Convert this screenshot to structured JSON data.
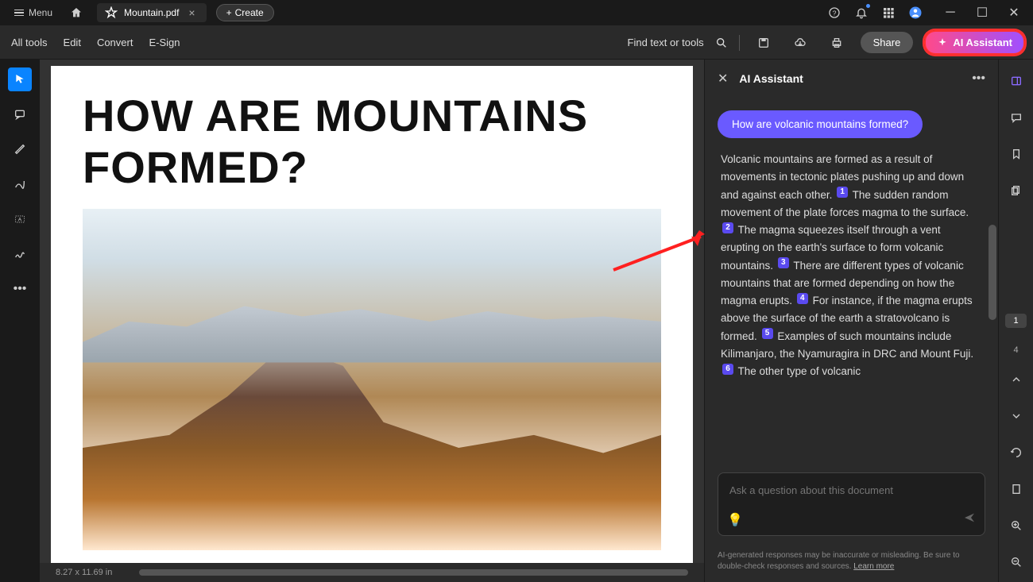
{
  "titlebar": {
    "menu_label": "Menu",
    "tab_name": "Mountain.pdf",
    "create_label": "Create"
  },
  "toolbar": {
    "all_tools": "All tools",
    "edit": "Edit",
    "convert": "Convert",
    "esign": "E-Sign",
    "find": "Find text or tools",
    "share": "Share",
    "ai_assistant": "AI Assistant"
  },
  "document": {
    "heading": "HOW ARE MOUNTAINS FORMED?",
    "page_size": "8.27 x 11.69 in"
  },
  "ai_panel": {
    "title": "AI Assistant",
    "question": "How are volcanic mountains formed?",
    "answer_p1": "Volcanic mountains are formed as a result of movements in tectonic plates pushing up and down and against each other.",
    "answer_p2": "The sudden random movement of the plate forces magma to the surface.",
    "answer_p3": "The magma squeezes itself through a vent erupting on the earth's surface to form volcanic mountains.",
    "answer_p4": "There are different types of volcanic mountains that are formed depending on how the magma erupts.",
    "answer_p5": "For instance, if the magma erupts above the surface of the earth a stratovolcano is formed.",
    "answer_p6": "Examples of such mountains include Kilimanjaro, the Nyamuragira in DRC and Mount Fuji.",
    "answer_p7": "The other type of volcanic",
    "citations": [
      "1",
      "2",
      "3",
      "4",
      "5",
      "6"
    ],
    "input_placeholder": "Ask a question about this document",
    "disclaimer_text": "AI-generated responses may be inaccurate or misleading. Be sure to double-check responses and sources.",
    "learn_more": "Learn more"
  },
  "right_panel": {
    "current_page": "1",
    "total_pages": "4"
  }
}
